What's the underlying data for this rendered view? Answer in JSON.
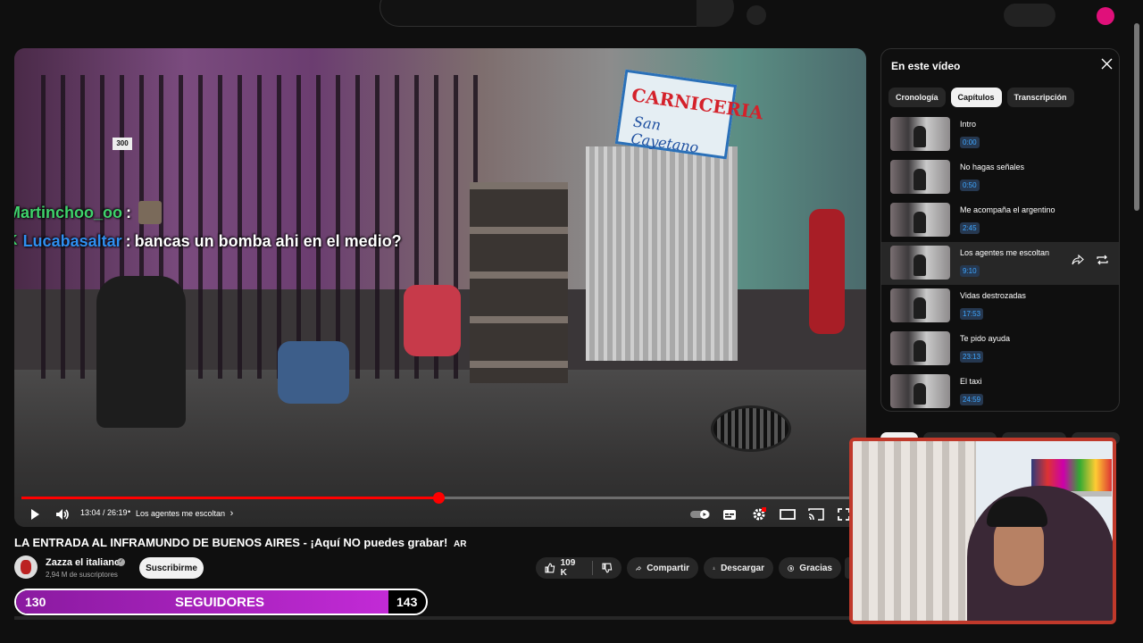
{
  "video": {
    "chat": [
      {
        "user": "Martinchoo_oo",
        "sep": " :",
        "message": ""
      },
      {
        "user": "Lucabasaltar",
        "sep": " :",
        "message": "bancas un bomba ahi en el medio?"
      }
    ],
    "sign_line1": "CARNICERIA",
    "sign_line2": "San Cayetano",
    "house_number": "300",
    "progress_fraction": 0.498,
    "time": "13:04 / 26:19",
    "chapter_label": "Los agentes me escoltan",
    "chapter_chevron": "›"
  },
  "meta": {
    "title": "LA ENTRADA AL INFRAMUNDO DE BUENOS AIRES - ¡Aquí NO puedes grabar!",
    "title_badge": "AR",
    "channel": "Zazza el italiano",
    "subscribers": "2,94 M de suscriptores",
    "subscribe_label": "Suscribirme",
    "likes": "109 K",
    "share_label": "Compartir",
    "download_label": "Descargar",
    "thanks_label": "Gracias"
  },
  "followers": {
    "current": "130",
    "label": "SEGUIDORES",
    "goal": "143",
    "fraction": 0.909
  },
  "panel": {
    "title": "En este vídeo",
    "tabs": [
      "Cronología",
      "Capítulos",
      "Transcripción"
    ],
    "active_tab": 1,
    "chapters": [
      {
        "title": "Intro",
        "time": "0:00"
      },
      {
        "title": "No hagas señales",
        "time": "0:50"
      },
      {
        "title": "Me acompaña el argentino",
        "time": "2:45"
      },
      {
        "title": "Los agentes me escoltan",
        "time": "9:10"
      },
      {
        "title": "Vidas destrozadas",
        "time": "17:53"
      },
      {
        "title": "Te pido ayuda",
        "time": "23:13"
      },
      {
        "title": "El taxi",
        "time": "24:59"
      }
    ],
    "selected_chapter": 3
  },
  "colors": {
    "accent": "#ff0000",
    "timestamp": "#3ea6ff",
    "followers_bar": "#c22ad6",
    "cam_border": "#c0392b"
  },
  "icons": [
    "play-icon",
    "volume-icon",
    "autoplay-toggle-icon",
    "subtitles-icon",
    "settings-icon",
    "theater-icon",
    "cast-icon",
    "fullscreen-icon",
    "like-icon",
    "dislike-icon",
    "share-icon",
    "download-icon",
    "thanks-icon",
    "close-icon",
    "share-chapter-icon",
    "loop-icon"
  ]
}
